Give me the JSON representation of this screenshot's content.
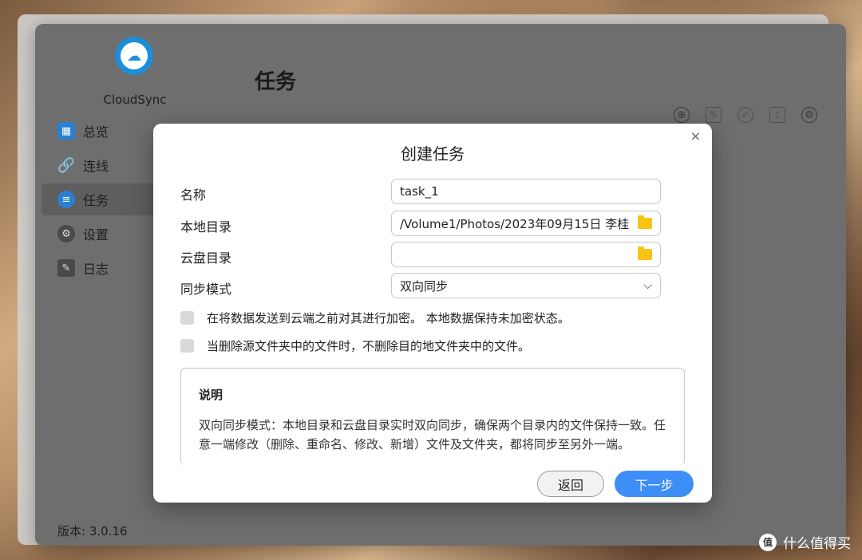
{
  "app": {
    "name": "CloudSync",
    "version_label": "版本: 3.0.16",
    "page_title": "任务"
  },
  "sidebar": {
    "items": [
      {
        "label": "总览",
        "icon": "grid-icon",
        "color": "#2a7fd0"
      },
      {
        "label": "连线",
        "icon": "link-icon",
        "color": "#3b8fd8"
      },
      {
        "label": "任务",
        "icon": "list-icon",
        "color": "#2a7fd0",
        "active": true
      },
      {
        "label": "设置",
        "icon": "gear-icon",
        "color": "#4a4a4a"
      },
      {
        "label": "日志",
        "icon": "document-icon",
        "color": "#4a4a4a"
      }
    ]
  },
  "toolbar": {
    "add": "⊕",
    "edit": "✎",
    "check": "✓",
    "delete": "🗑",
    "settings": "⚙"
  },
  "dialog": {
    "title": "创建任务",
    "close": "×",
    "fields": {
      "name": {
        "label": "名称",
        "value": "task_1"
      },
      "local_dir": {
        "label": "本地目录",
        "value": "/Volume1/Photos/2023年09月15日 李桂"
      },
      "cloud_dir": {
        "label": "云盘目录",
        "value": ""
      },
      "sync_mode": {
        "label": "同步模式",
        "value": "双向同步"
      }
    },
    "checkboxes": {
      "encrypt": "在将数据发送到云端之前对其进行加密。 本地数据保持未加密状态。",
      "no_delete": "当删除源文件夹中的文件时，不删除目的地文件夹中的文件。"
    },
    "description": {
      "title": "说明",
      "text": "双向同步模式：本地目录和云盘目录实时双向同步，确保两个目录内的文件保持一致。任意一端修改（删除、重命名、修改、新增）文件及文件夹，都将同步至另外一端。"
    },
    "buttons": {
      "back": "返回",
      "next": "下一步"
    }
  },
  "watermark": {
    "logo_text": "值",
    "text": "什么值得买"
  },
  "colors": {
    "primary": "#3d8ef6",
    "folder": "#f7c415"
  }
}
